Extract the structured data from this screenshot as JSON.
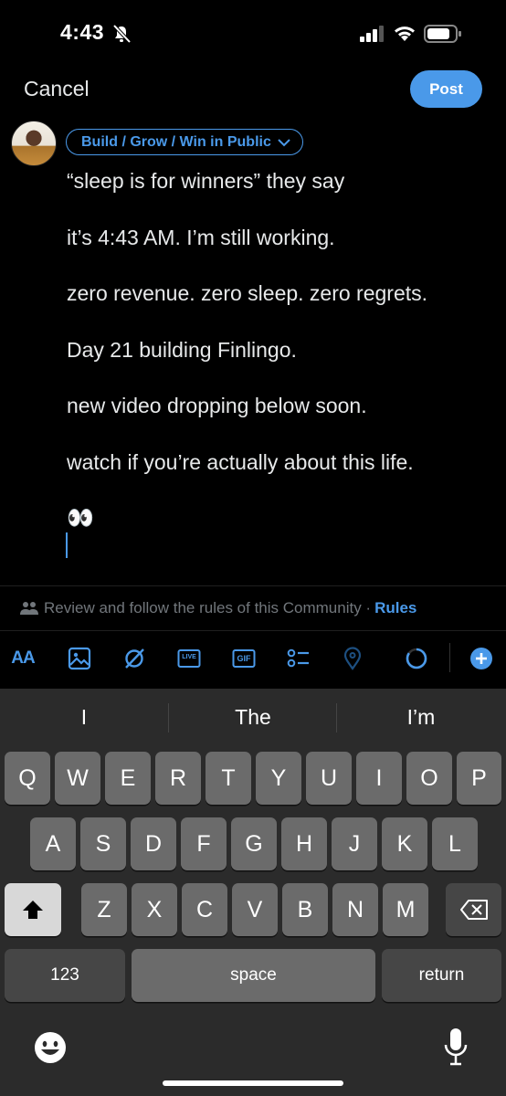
{
  "status_bar": {
    "time": "4:43"
  },
  "top_bar": {
    "cancel_label": "Cancel",
    "post_label": "Post"
  },
  "community": {
    "name": "Build / Grow / Win in Public"
  },
  "post": {
    "lines": [
      "“sleep is for winners” they say",
      "it’s 4:43 AM. I’m still working.",
      "zero revenue. zero sleep. zero regrets.",
      "Day 21 building Finlingo.",
      "new video dropping below soon.",
      "watch if you’re actually about this life."
    ],
    "emoji": "👀"
  },
  "rules_bar": {
    "text": "Review and follow the rules of this Community ·",
    "link": "Rules"
  },
  "toolbar": {
    "text_size_label": "AA",
    "live_label": "LIVE",
    "gif_label": "GIF"
  },
  "keyboard": {
    "suggestions": [
      "I",
      "The",
      "I’m"
    ],
    "row1": [
      "Q",
      "W",
      "E",
      "R",
      "T",
      "Y",
      "U",
      "I",
      "O",
      "P"
    ],
    "row2": [
      "A",
      "S",
      "D",
      "F",
      "G",
      "H",
      "J",
      "K",
      "L"
    ],
    "row3": [
      "Z",
      "X",
      "C",
      "V",
      "B",
      "N",
      "M"
    ],
    "numbers_label": "123",
    "space_label": "space",
    "return_label": "return"
  },
  "colors": {
    "accent": "#4a99e9",
    "background": "#000000",
    "keyboard_bg": "#2b2b2b"
  }
}
